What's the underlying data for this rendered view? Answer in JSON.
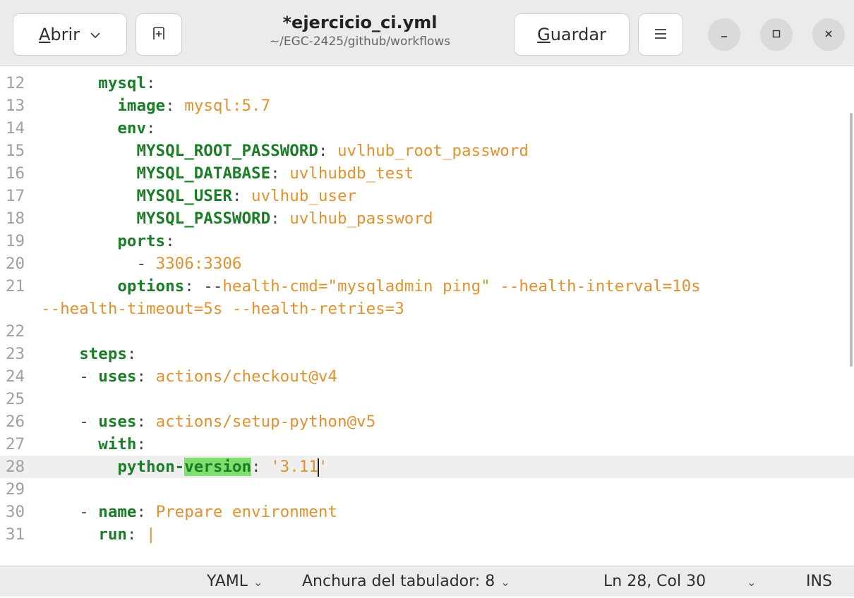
{
  "header": {
    "open_label": "Abrir",
    "save_label": "Guardar",
    "title": "*ejercicio_ci.yml",
    "path": "~/EGC-2425/github/workflows"
  },
  "icons": {
    "open_dropdown": "chevron-down-icon",
    "new_tab": "new-tab-icon",
    "menu": "hamburger-menu-icon",
    "minimize": "minimize-icon",
    "maximize": "maximize-icon",
    "close": "close-icon"
  },
  "editor": {
    "current_line": "28",
    "lines": [
      {
        "num": "12",
        "indent": "      ",
        "parts": [
          {
            "t": "mysql",
            "c": "k"
          },
          {
            "t": ":",
            "c": "p"
          }
        ]
      },
      {
        "num": "13",
        "indent": "        ",
        "parts": [
          {
            "t": "image",
            "c": "k"
          },
          {
            "t": ": ",
            "c": "p"
          },
          {
            "t": "mysql:5.7",
            "c": "v"
          }
        ]
      },
      {
        "num": "14",
        "indent": "        ",
        "parts": [
          {
            "t": "env",
            "c": "k"
          },
          {
            "t": ":",
            "c": "p"
          }
        ]
      },
      {
        "num": "15",
        "indent": "          ",
        "parts": [
          {
            "t": "MYSQL_ROOT_PASSWORD",
            "c": "k"
          },
          {
            "t": ": ",
            "c": "p"
          },
          {
            "t": "uvlhub_root_password",
            "c": "v"
          }
        ]
      },
      {
        "num": "16",
        "indent": "          ",
        "parts": [
          {
            "t": "MYSQL_DATABASE",
            "c": "k"
          },
          {
            "t": ": ",
            "c": "p"
          },
          {
            "t": "uvlhubdb_test",
            "c": "v"
          }
        ]
      },
      {
        "num": "17",
        "indent": "          ",
        "parts": [
          {
            "t": "MYSQL_USER",
            "c": "k"
          },
          {
            "t": ": ",
            "c": "p"
          },
          {
            "t": "uvlhub_user",
            "c": "v"
          }
        ]
      },
      {
        "num": "18",
        "indent": "          ",
        "parts": [
          {
            "t": "MYSQL_PASSWORD",
            "c": "k"
          },
          {
            "t": ": ",
            "c": "p"
          },
          {
            "t": "uvlhub_password",
            "c": "v"
          }
        ]
      },
      {
        "num": "19",
        "indent": "        ",
        "parts": [
          {
            "t": "ports",
            "c": "k"
          },
          {
            "t": ":",
            "c": "p"
          }
        ]
      },
      {
        "num": "20",
        "indent": "          ",
        "parts": [
          {
            "t": "- ",
            "c": "p"
          },
          {
            "t": "3306:3306",
            "c": "v"
          }
        ]
      },
      {
        "num": "21",
        "indent": "        ",
        "parts": [
          {
            "t": "options",
            "c": "k"
          },
          {
            "t": ": --",
            "c": "p"
          },
          {
            "t": "health-cmd=\"mysqladmin ping\" --health-interval=10s",
            "c": "v"
          }
        ]
      },
      {
        "num": "",
        "indent": "",
        "parts": [
          {
            "t": "--health-timeout=5s --health-retries=3",
            "c": "v"
          }
        ]
      },
      {
        "num": "22",
        "indent": "",
        "parts": []
      },
      {
        "num": "23",
        "indent": "    ",
        "parts": [
          {
            "t": "steps",
            "c": "k"
          },
          {
            "t": ":",
            "c": "p"
          }
        ]
      },
      {
        "num": "24",
        "indent": "    ",
        "parts": [
          {
            "t": "- ",
            "c": "p"
          },
          {
            "t": "uses",
            "c": "k"
          },
          {
            "t": ": ",
            "c": "p"
          },
          {
            "t": "actions/checkout@v4",
            "c": "v"
          }
        ]
      },
      {
        "num": "25",
        "indent": "",
        "parts": []
      },
      {
        "num": "26",
        "indent": "    ",
        "parts": [
          {
            "t": "- ",
            "c": "p"
          },
          {
            "t": "uses",
            "c": "k"
          },
          {
            "t": ": ",
            "c": "p"
          },
          {
            "t": "actions/setup-python@v5",
            "c": "v"
          }
        ]
      },
      {
        "num": "27",
        "indent": "      ",
        "parts": [
          {
            "t": "with",
            "c": "k"
          },
          {
            "t": ":",
            "c": "p"
          }
        ]
      },
      {
        "num": "28",
        "indent": "        ",
        "parts": [
          {
            "t": "python-",
            "c": "k"
          },
          {
            "t": "version",
            "c": "k hl"
          },
          {
            "t": ": ",
            "c": "p"
          },
          {
            "t": "'3.11",
            "c": "v"
          },
          {
            "t": "",
            "c": "caret"
          },
          {
            "t": "'",
            "c": "v"
          }
        ]
      },
      {
        "num": "29",
        "indent": "",
        "parts": []
      },
      {
        "num": "30",
        "indent": "    ",
        "parts": [
          {
            "t": "- ",
            "c": "p"
          },
          {
            "t": "name",
            "c": "k"
          },
          {
            "t": ": ",
            "c": "p"
          },
          {
            "t": "Prepare environment",
            "c": "v"
          }
        ]
      },
      {
        "num": "31",
        "indent": "      ",
        "parts": [
          {
            "t": "run",
            "c": "k"
          },
          {
            "t": ": ",
            "c": "p"
          },
          {
            "t": "|",
            "c": "v"
          }
        ]
      }
    ]
  },
  "status": {
    "language": "YAML",
    "tab_width": "Anchura del tabulador: 8",
    "position": "Ln 28, Col 30",
    "mode": "INS"
  }
}
